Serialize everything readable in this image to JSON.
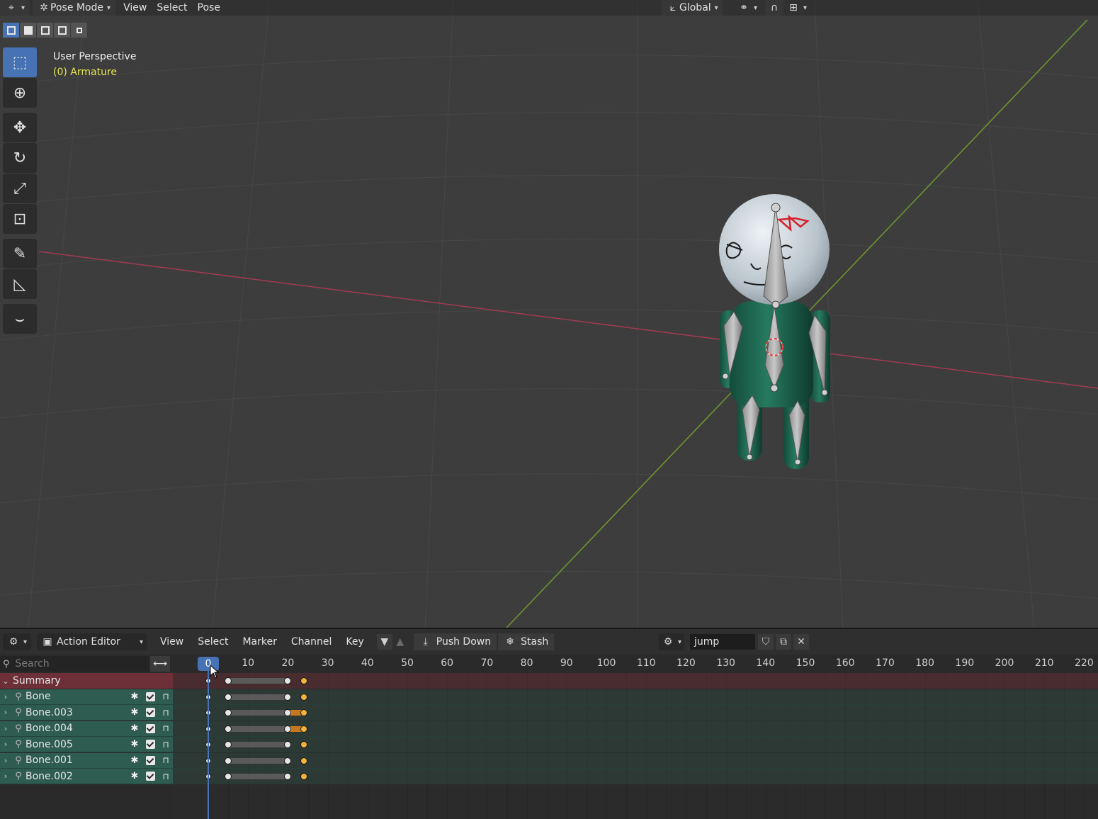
{
  "viewport": {
    "mode": "Pose Mode",
    "menus": [
      "View",
      "Select",
      "Pose"
    ],
    "orientation": "Global",
    "overlay_title": "User Perspective",
    "overlay_object": "(0) Armature"
  },
  "toolbar_icons": [
    "select-box-icon",
    "cursor-icon",
    "move-icon",
    "rotate-icon",
    "scale-icon",
    "transform-icon",
    "annotate-icon",
    "measure-icon",
    "relax-icon"
  ],
  "editor": {
    "type": "Action Editor",
    "menus": [
      "View",
      "Select",
      "Marker",
      "Channel",
      "Key"
    ],
    "push_down": "Push Down",
    "stash": "Stash",
    "action_name": "jump",
    "search_placeholder": "Search",
    "summary": "Summary",
    "channels": [
      "Bone",
      "Bone.003",
      "Bone.004",
      "Bone.005",
      "Bone.001",
      "Bone.002"
    ],
    "current_frame": "0",
    "ruler": [
      "10",
      "20",
      "30",
      "40",
      "50",
      "60",
      "70",
      "80",
      "90",
      "100",
      "110",
      "120",
      "130",
      "140",
      "150",
      "160",
      "170",
      "180",
      "190",
      "200",
      "210",
      "220"
    ]
  },
  "keyframes": {
    "frames": [
      0,
      5,
      20,
      24
    ],
    "selected_frame": 24,
    "orange_hold_rows": [
      1,
      2
    ]
  },
  "colors": {
    "accent": "#4772b3",
    "summary_row": "#6d2f38",
    "bone_row": "#2f5c50",
    "selected_key": "#f0b43c",
    "object_label": "#e6e64d"
  }
}
